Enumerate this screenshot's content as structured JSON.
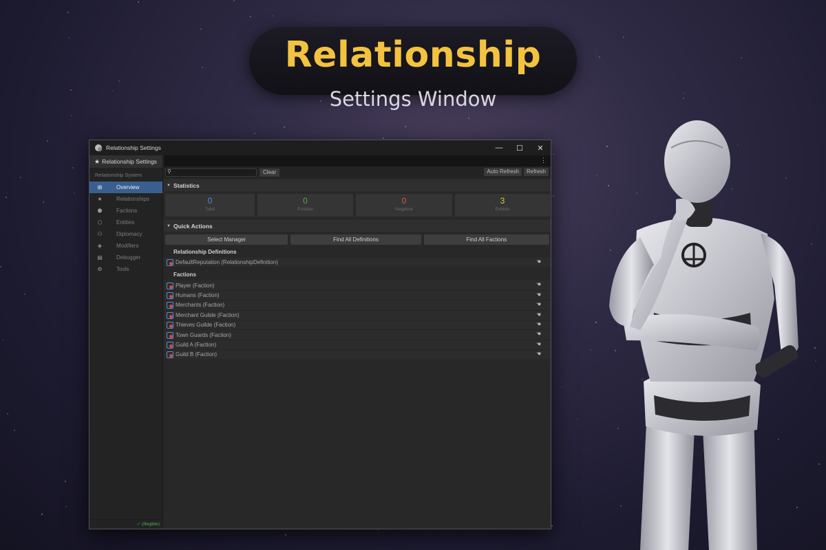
{
  "hero": {
    "title": "Relationship",
    "subtitle": "Settings Window"
  },
  "window": {
    "title": "Relationship Settings",
    "controls": {
      "minimize": "—",
      "maximize": "☐",
      "close": "✕"
    }
  },
  "sidebar": {
    "header": "Relationship Settings",
    "subheader": "Relationship System",
    "items": [
      {
        "label": "Overview",
        "icon": "grid-icon",
        "glyph": "⊞",
        "active": true
      },
      {
        "label": "Relationships",
        "icon": "star-icon",
        "glyph": "★",
        "active": false
      },
      {
        "label": "Factions",
        "icon": "cube-icon",
        "glyph": "⬢",
        "active": false
      },
      {
        "label": "Entities",
        "icon": "box-icon",
        "glyph": "⬡",
        "active": false
      },
      {
        "label": "Diplomacy",
        "icon": "people-icon",
        "glyph": "⚇",
        "active": false
      },
      {
        "label": "Modifiers",
        "icon": "shapes-icon",
        "glyph": "◈",
        "active": false
      },
      {
        "label": "Debugger",
        "icon": "list-icon",
        "glyph": "▤",
        "active": false
      },
      {
        "label": "Tools",
        "icon": "gear-icon",
        "glyph": "⚙",
        "active": false
      }
    ],
    "footer": "✓ (illegible)"
  },
  "toolbar": {
    "search_value": "",
    "clear": "Clear",
    "auto_refresh": "Auto Refresh",
    "refresh": "Refresh"
  },
  "statistics": {
    "title": "Statistics",
    "cards": [
      {
        "value": "0",
        "label": "Total",
        "color": "#4a8ee0"
      },
      {
        "value": "0",
        "label": "Positive",
        "color": "#4fae4f"
      },
      {
        "value": "0",
        "label": "Negative",
        "color": "#d9534f"
      },
      {
        "value": "3",
        "label": "Entities",
        "color": "#d8c84a"
      }
    ]
  },
  "quick_actions": {
    "title": "Quick Actions",
    "buttons": [
      "Select Manager",
      "Find All Definitions",
      "Find All Factions"
    ]
  },
  "relationship_definitions": {
    "title": "Relationship Definitions",
    "items": [
      "DefaultReputation (RelationshipDefinition)"
    ]
  },
  "factions": {
    "title": "Factions",
    "items": [
      "Player (Faction)",
      "Humans (Faction)",
      "Merchants (Faction)",
      "Merchant Guilde (Faction)",
      "Thieves Guilde (Faction)",
      "Town Guards (Faction)",
      "Guild A (Faction)",
      "Guild B (Faction)"
    ]
  },
  "colors": {
    "accent_title": "#f3c340",
    "active_item": "#3a5f8f"
  }
}
